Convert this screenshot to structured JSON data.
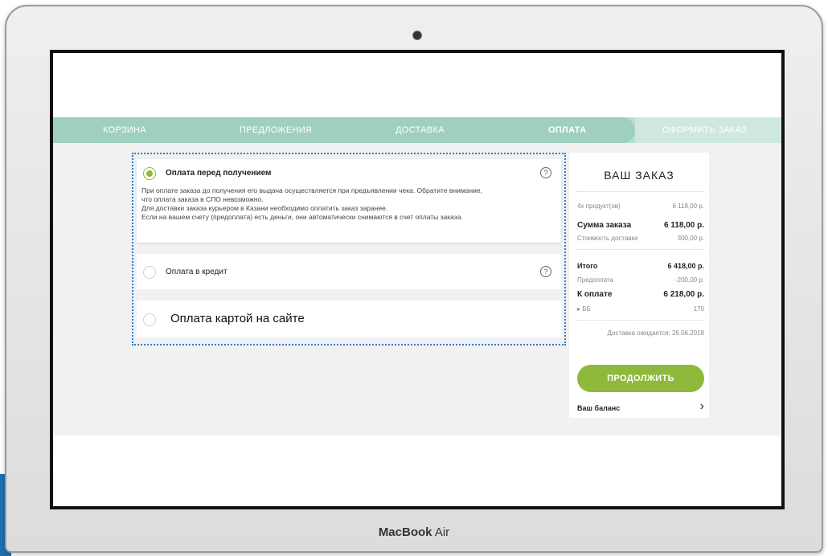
{
  "device": {
    "brand_bold": "MacBook",
    "brand_light": " Air"
  },
  "steps": [
    {
      "label": "КОРЗИНА"
    },
    {
      "label": "ПРЕДЛОЖЕНИЯ"
    },
    {
      "label": "ДОСТАВКА"
    },
    {
      "label": "ОПЛАТА"
    },
    {
      "label": "ОФОРМИТЬ ЗАКАЗ"
    }
  ],
  "payment": {
    "options": [
      {
        "title": "Оплата перед получением",
        "selected": true,
        "help": "?",
        "description": [
          "При оплате заказа до получения его выдача осуществляется при предъявлении чека. Обратите внимание,",
          "что оплата заказа в СПО невозможно.",
          "Для доставки заказа курьером в Казани необходимо оплатить заказ заранее.",
          "Если на вашем счету (предоплата) есть деньги, они автоматически снимаются в счет оплаты заказа."
        ]
      },
      {
        "title": "Оплата в кредит",
        "selected": false,
        "help": "?"
      },
      {
        "title": "Оплата картой на сайте",
        "selected": false
      }
    ]
  },
  "order": {
    "title": "ВАШ ЗАКАЗ",
    "products_label": "4x продукт(ов)",
    "products_value": "6 118,00 р.",
    "sum_label": "Сумма заказа",
    "sum_value": "6 118,00 р.",
    "delivery_label": "Стоимость доставки",
    "delivery_value": "300,00 р.",
    "total_label": "Итого",
    "total_value": "6 418,00 р.",
    "prepay_label": "Предоплата",
    "prepay_value": "-200,00 р.",
    "topay_label": "К оплате",
    "topay_value": "6 218,00 р.",
    "bb_label": "▸  ББ",
    "bb_value": "170",
    "expected": "Доставка ожидается: 26.06.2018",
    "continue_label": "ПРОДОЛЖИТЬ",
    "balance_label": "Ваш баланс",
    "balance_chevron": "›"
  },
  "colors": {
    "accent": "#8fb93a",
    "step_bar": "#b9ddd1",
    "focus_outline": "#2a7fd0"
  }
}
